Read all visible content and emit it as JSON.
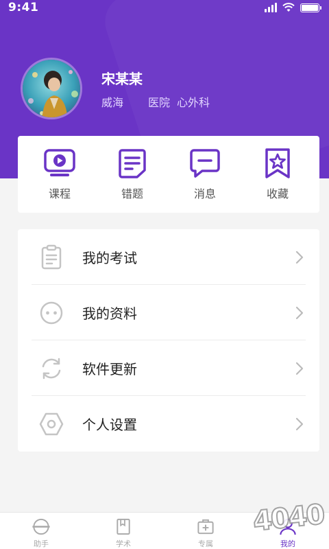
{
  "status_bar": {
    "time": "9:41",
    "battery_level": 1.0
  },
  "profile": {
    "name": "宋某某",
    "city": "威海",
    "hospital": "医院",
    "department": "心外科"
  },
  "quick_actions": [
    {
      "label": "课程",
      "icon": "video-play-icon"
    },
    {
      "label": "错题",
      "icon": "notebook-icon"
    },
    {
      "label": "消息",
      "icon": "message-icon"
    },
    {
      "label": "收藏",
      "icon": "star-bookmark-icon"
    }
  ],
  "menu": [
    {
      "label": "我的考试",
      "icon": "clipboard-icon"
    },
    {
      "label": "我的资料",
      "icon": "face-icon"
    },
    {
      "label": "软件更新",
      "icon": "refresh-icon"
    },
    {
      "label": "个人设置",
      "icon": "hexagon-settings-icon"
    }
  ],
  "tabs": [
    {
      "label": "助手",
      "icon": "helper-icon",
      "active": false
    },
    {
      "label": "学术",
      "icon": "book-icon",
      "active": false
    },
    {
      "label": "专属",
      "icon": "medical-kit-icon",
      "active": false
    },
    {
      "label": "我的",
      "icon": "user-icon",
      "active": true
    }
  ],
  "watermark": "4040",
  "colors": {
    "brand": "#6a34c6",
    "card": "#ffffff",
    "background": "#f4f4f4",
    "icon_grey": "#c4c4c4"
  }
}
